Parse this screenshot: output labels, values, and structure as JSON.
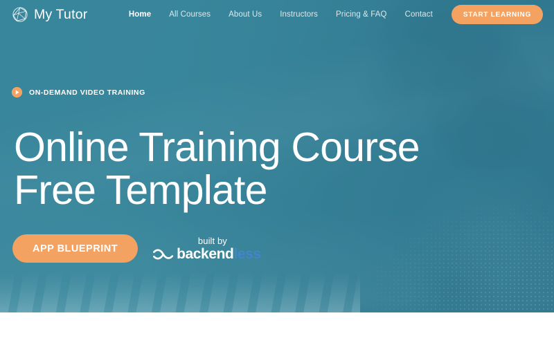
{
  "header": {
    "brand": {
      "icon": "geodesic-sphere-icon",
      "name": "My Tutor"
    },
    "nav": [
      {
        "label": "Home",
        "active": true
      },
      {
        "label": "All Courses",
        "active": false
      },
      {
        "label": "About Us",
        "active": false
      },
      {
        "label": "Instructors",
        "active": false
      },
      {
        "label": "Pricing & FAQ",
        "active": false
      },
      {
        "label": "Contact",
        "active": false
      }
    ],
    "cta": {
      "label": "START LEARNING"
    }
  },
  "hero": {
    "eyebrow": {
      "icon": "play-circle-icon",
      "text": "ON-DEMAND VIDEO TRAINING"
    },
    "title_line1": "Online Training Course",
    "title_line2": "Free Template",
    "primary_button": {
      "label": "APP BLUEPRINT"
    },
    "built_by": {
      "label": "built by",
      "icon": "backendless-swoosh-icon",
      "wordmark_part1": "backend",
      "wordmark_part2": "less"
    }
  },
  "colors": {
    "teal_overlay": "#38859b",
    "orange_accent": "#f4a261",
    "white": "#ffffff",
    "backendless_blue": "#4185cc",
    "page_background": "#ffffff"
  }
}
